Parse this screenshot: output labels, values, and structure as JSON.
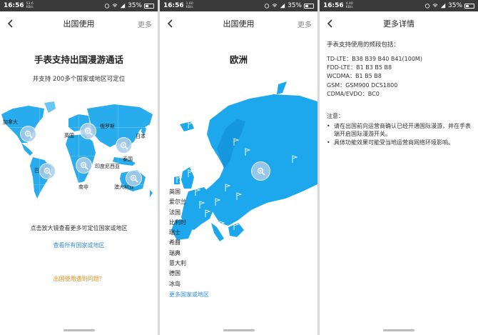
{
  "status": {
    "time": "16:56",
    "speeds": [
      "53.6 KB/s",
      "1.60 KB/s",
      "4.40 KB/s"
    ],
    "battery": "35%"
  },
  "screen1": {
    "title": "出国使用",
    "more": "更多",
    "heading": "手表支持出国漫游通话",
    "subheading": "并支持 200多个国家或地区可定位",
    "map_labels": {
      "canada": "加拿大",
      "russia": "俄罗斯",
      "uk": "英国",
      "japan": "日本",
      "thailand": "泰国",
      "indonesia": "印度尼西亚",
      "brazil": "巴西",
      "south_africa": "南非",
      "australia": "澳大利亚"
    },
    "hint": "点击放大镜查看更多可定位国家或地区",
    "view_all_link": "查看所有国家或地区",
    "problem_link": "出国使用遇到问题？"
  },
  "screen2": {
    "title": "出国使用",
    "more": "更多",
    "heading": "欧洲",
    "countries": [
      "英国",
      "爱尔兰",
      "法国",
      "比利时",
      "瑞士",
      "希腊",
      "瑞典",
      "意大利",
      "德国",
      "冰岛"
    ],
    "more_link": "更多国家或地区"
  },
  "screen3": {
    "title": "更多详情",
    "heading": "手表支持使用的频段包括：",
    "bands": [
      "TD-LTE：B38 B39 B40 B41(100M)",
      "FDD-LTE：B1 B3 B5 B8",
      "WCDMA：B1 B5 B8",
      "GSM：GSM900  DCS1800",
      "CDMA/EVDO：BC0"
    ],
    "note_title": "注意：",
    "notes": [
      "请在出国前向运营商确认已经开通国际漫游，并在手表端开启国际漫游开关。",
      "具体功能效果可能受当地运营商网络环境影响。"
    ]
  },
  "colors": {
    "map_blue": "#1da8ee",
    "link_blue": "#2f8ee0",
    "orange": "#f28a1a",
    "status_bar": "#3a3a3a"
  }
}
